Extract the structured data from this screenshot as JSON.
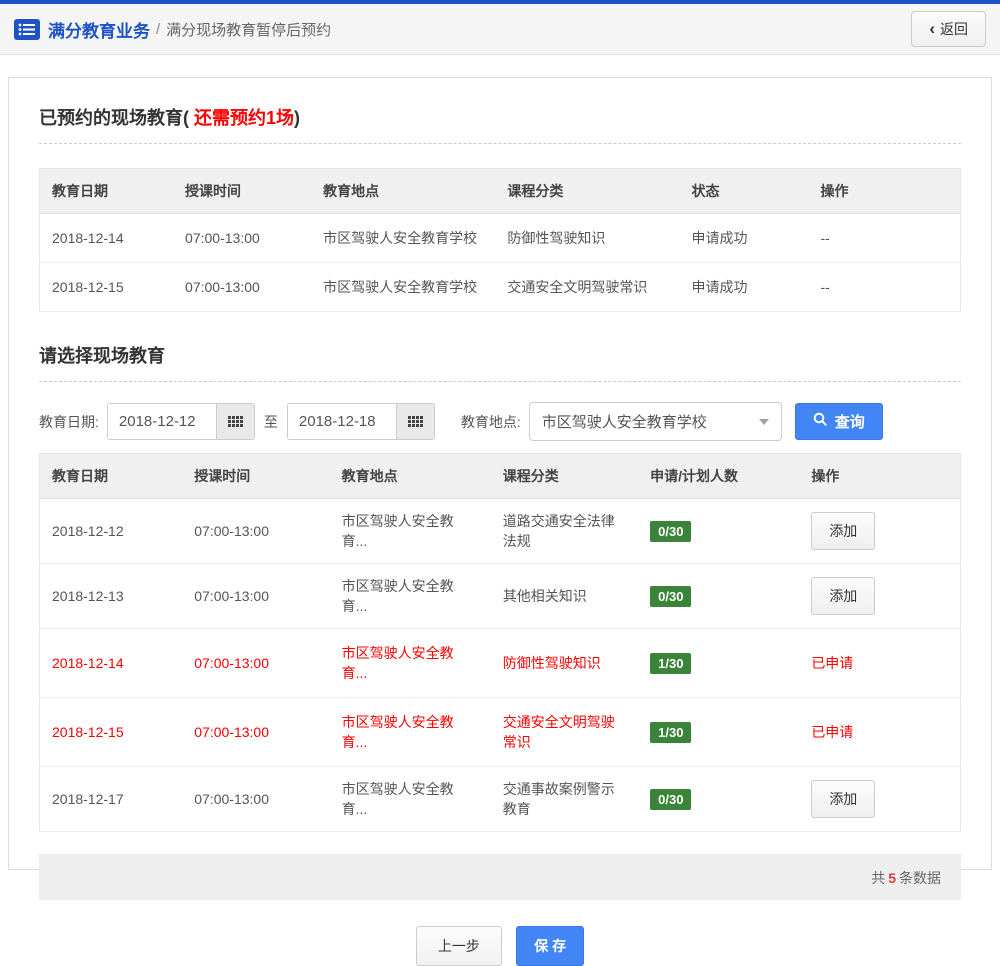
{
  "colors": {
    "accent_blue": "#1d53c5",
    "button_blue": "#4285f4",
    "alert_red": "#ff0000",
    "badge_green": "#398439"
  },
  "header": {
    "breadcrumb_root": "满分教育业务",
    "breadcrumb_sep": "/",
    "breadcrumb_current": "满分现场教育暂停后预约",
    "back_chevron": "‹",
    "back_label": "返回"
  },
  "booked": {
    "title_prefix": "已预约的现场教育(",
    "title_highlight": " 还需预约1场",
    "title_suffix": ")",
    "table": {
      "columns": [
        "教育日期",
        "授课时间",
        "教育地点",
        "课程分类",
        "状态",
        "操作"
      ],
      "rows": [
        {
          "date": "2018-12-14",
          "time": "07:00-13:00",
          "place": "市区驾驶人安全教育学校",
          "course": "防御性驾驶知识",
          "status": "申请成功",
          "action": "--"
        },
        {
          "date": "2018-12-15",
          "time": "07:00-13:00",
          "place": "市区驾驶人安全教育学校",
          "course": "交通安全文明驾驶常识",
          "status": "申请成功",
          "action": "--"
        }
      ]
    }
  },
  "choose": {
    "title": "请选择现场教育",
    "filter": {
      "date_label": "教育日期:",
      "date_from": "2018-12-12",
      "to_label": "至",
      "date_to": "2018-12-18",
      "place_label": "教育地点:",
      "place_value": "市区驾驶人安全教育学校",
      "search_label": "查询"
    },
    "table": {
      "columns": [
        "教育日期",
        "授课时间",
        "教育地点",
        "课程分类",
        "申请/计划人数",
        "操作"
      ],
      "rows": [
        {
          "date": "2018-12-12",
          "time": "07:00-13:00",
          "place": "市区驾驶人安全教育...",
          "course": "道路交通安全法律法规",
          "count": "0/30",
          "action": "添加"
        },
        {
          "date": "2018-12-13",
          "time": "07:00-13:00",
          "place": "市区驾驶人安全教育...",
          "course": "其他相关知识",
          "count": "0/30",
          "action": "添加"
        },
        {
          "date": "2018-12-14",
          "time": "07:00-13:00",
          "place": "市区驾驶人安全教育...",
          "course": "防御性驾驶知识",
          "count": "1/30",
          "action": "已申请"
        },
        {
          "date": "2018-12-15",
          "time": "07:00-13:00",
          "place": "市区驾驶人安全教育...",
          "course": "交通安全文明驾驶常识",
          "count": "1/30",
          "action": "已申请"
        },
        {
          "date": "2018-12-17",
          "time": "07:00-13:00",
          "place": "市区驾驶人安全教育...",
          "course": "交通事故案例警示教育",
          "count": "0/30",
          "action": "添加"
        }
      ]
    },
    "footer": {
      "total_prefix": "共",
      "total_count": "5",
      "total_suffix": "条数据"
    }
  },
  "actions": {
    "prev_label": "上一步",
    "save_label": "保 存"
  }
}
